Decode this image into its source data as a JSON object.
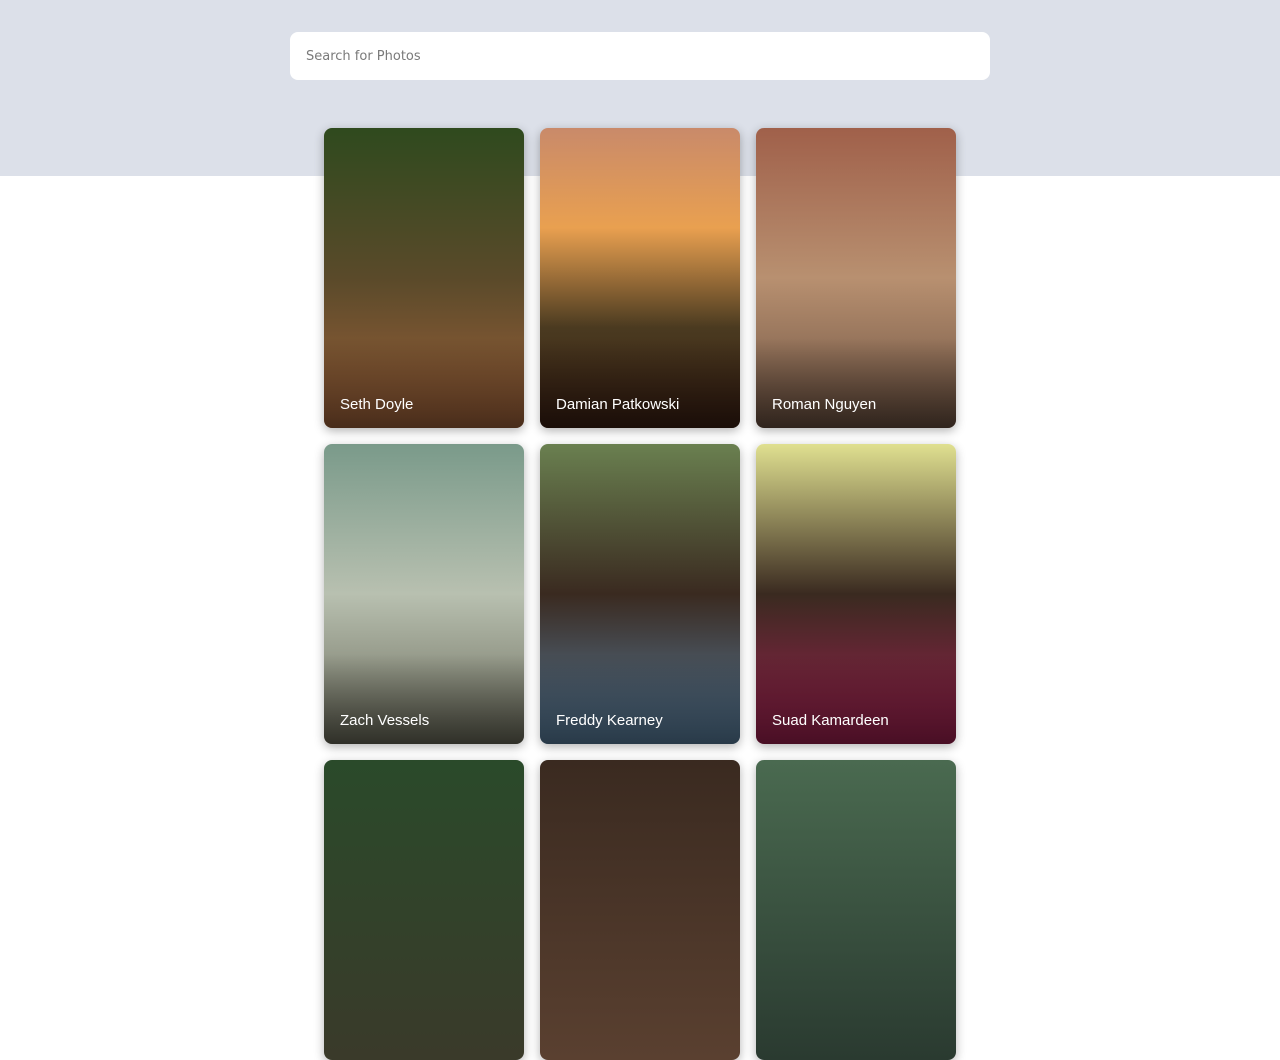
{
  "search": {
    "placeholder": "Search for Photos",
    "value": ""
  },
  "photos": [
    {
      "author": "Seth Doyle",
      "colors": [
        "#2f4a1e",
        "#5a4a2a",
        "#a0623a"
      ]
    },
    {
      "author": "Damian Patkowski",
      "colors": [
        "#c98a6a",
        "#e9a050",
        "#4a3a20",
        "#3a1e12"
      ]
    },
    {
      "author": "Roman Nguyen",
      "colors": [
        "#a0604a",
        "#b89070",
        "#6a5040"
      ]
    },
    {
      "author": "Zach Vessels",
      "colors": [
        "#7a9a8a",
        "#b8c0b0",
        "#6a6a5a"
      ]
    },
    {
      "author": "Freddy Kearney",
      "colors": [
        "#6a8050",
        "#3a2a20",
        "#5a80a0"
      ]
    },
    {
      "author": "Suad Kamardeen",
      "colors": [
        "#e0e090",
        "#3a2a20",
        "#a02050"
      ]
    },
    {
      "author": "",
      "colors": [
        "#2a4a2a",
        "#3a3a2a"
      ]
    },
    {
      "author": "",
      "colors": [
        "#3a2a20",
        "#5a4030"
      ]
    },
    {
      "author": "",
      "colors": [
        "#4a6a50",
        "#2a3a30"
      ]
    }
  ]
}
